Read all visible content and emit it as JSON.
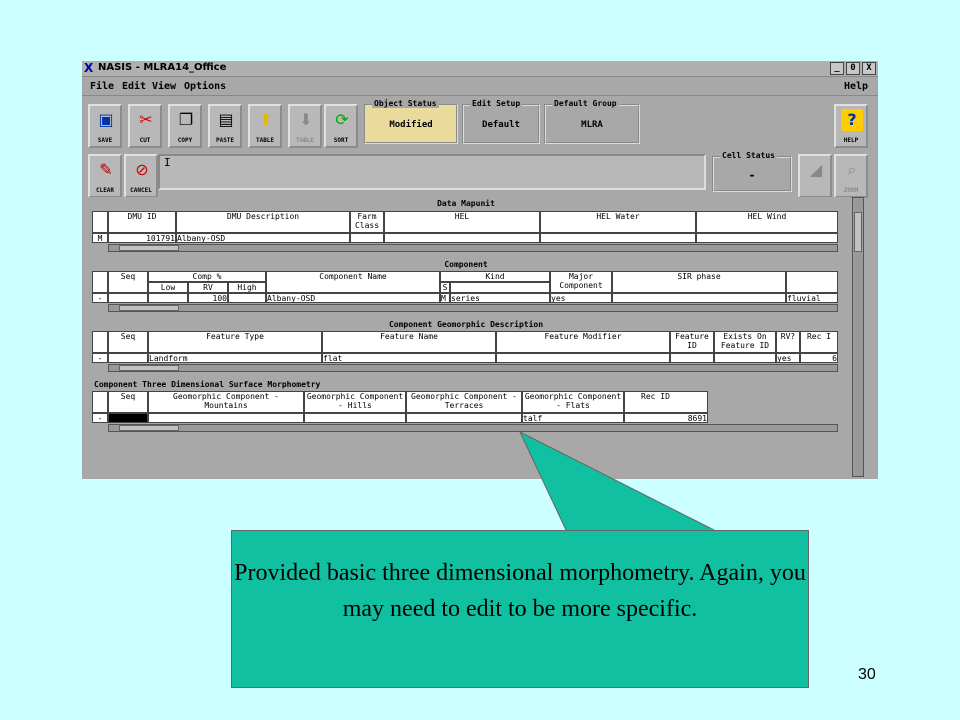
{
  "window": {
    "title": "NASIS - MLRA14_Office",
    "controls": [
      "_",
      "0",
      "X"
    ]
  },
  "menu": {
    "file": "File",
    "edit": "Edit",
    "view": "View",
    "options": "Options",
    "help": "Help"
  },
  "toolbar": {
    "buttons": [
      "SAVE",
      "CUT",
      "COPY",
      "PASTE",
      "TABLE",
      "TABLE",
      "SORT",
      "HELP"
    ],
    "row2_buttons": [
      "CLEAR",
      "CANCEL",
      "ZOOM"
    ],
    "groups": {
      "object_status": {
        "label": "Object Status",
        "value": "Modified"
      },
      "edit_setup": {
        "label": "Edit Setup",
        "value": "Default"
      },
      "default_group": {
        "label": "Default Group",
        "value": "MLRA"
      }
    },
    "cell_status": {
      "label": "Cell Status",
      "value": "-"
    },
    "edit_field": "I"
  },
  "data_mapunit": {
    "title": "Data Mapunit",
    "headers": [
      "DMU ID",
      "DMU Description",
      "Farm Class",
      "HEL",
      "HEL Water",
      "HEL Wind"
    ],
    "row_marker": "M",
    "row": [
      "101791",
      "Albany-OSD",
      "",
      "",
      "",
      ""
    ]
  },
  "component": {
    "title": "Component",
    "headers": [
      "Seq",
      "Comp %",
      "Component Name",
      "Kind",
      "Major Component",
      "SIR phase"
    ],
    "subheaders": [
      "Low",
      "RV",
      "High",
      "S"
    ],
    "row_marker": "-",
    "row": [
      "",
      "",
      "100",
      "",
      "Albany-OSD",
      "M",
      "series",
      "yes",
      "",
      "fluvial"
    ]
  },
  "geomorphic": {
    "title": "Component Geomorphic Description",
    "headers": [
      "Seq",
      "Feature Type",
      "Feature Name",
      "Feature Modifier",
      "Feature ID",
      "Exists On Feature ID",
      "RV?",
      "Rec I"
    ],
    "row_marker": "-",
    "row": [
      "",
      "Landform",
      "flat",
      "",
      "",
      "",
      "yes",
      "6"
    ]
  },
  "three_d": {
    "title": "Component Three Dimensional Surface Morphometry",
    "headers": [
      "Seq",
      "Geomorphic Component - Mountains",
      "Geomorphic Component - Hills",
      "Geomorphic Component - Terraces",
      "Geomorphic Component - Flats",
      "Rec ID"
    ],
    "row_marker": "-",
    "row": [
      "",
      "",
      "",
      "",
      "talf",
      "8691"
    ]
  },
  "callout": {
    "text": "Provided basic three dimensional morphometry. Again, you may need to edit to be more specific."
  },
  "slide_number": "30"
}
